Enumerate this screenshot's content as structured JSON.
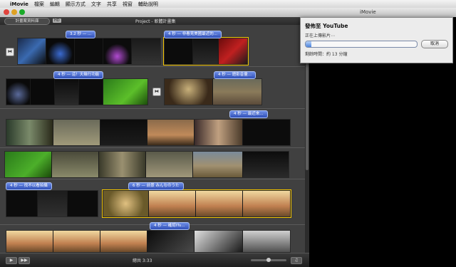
{
  "menubar": {
    "apple": "",
    "app": "iMovie",
    "items": [
      "檔案",
      "編輯",
      "顯示方式",
      "文字",
      "共享",
      "視窗",
      "輔助說明"
    ]
  },
  "window": {
    "title": "iMovie"
  },
  "project_bar": {
    "library_button": "計畫案資料庫",
    "hd_badge": "HD",
    "project_title": "Project - 軟體計畫集"
  },
  "clip_titles": [
    "3.2 秒 — ...",
    "4 秒 — 非看見美國最近的...",
    "4 秒 — 這！天幾行功能",
    "4 秒 — 語影音量...",
    "4 秒 — 最近來...",
    "4 秒 — 找不以看拍攝",
    "6 秒 — 前景 みんなのうた",
    "4 秒 — 確認ITu..."
  ],
  "transition_icon": "⧓",
  "status": {
    "total_label": "總共 3:33"
  },
  "bottom_buttons": [
    "▶",
    "▶▶"
  ],
  "right_buttons": [
    "■",
    "♫"
  ],
  "zoom": 0.5,
  "upload_sheet": {
    "title": "發佈至 YouTube",
    "status": "正在上傳影片⋯",
    "progress": 0.05,
    "cancel": "取消",
    "time_remaining": "剩餘時間：約 13 分鐘"
  },
  "colors": {
    "selection": "#f3c400",
    "title_bubble": "#3d5fc8",
    "progress": "#4d84dc"
  }
}
